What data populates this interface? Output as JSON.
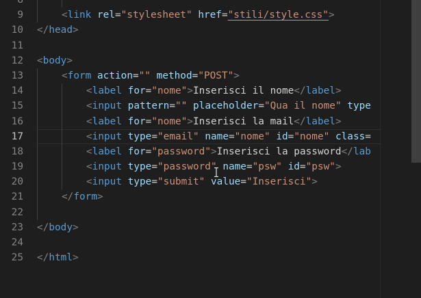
{
  "line_numbers": [
    "8",
    "9",
    "10",
    "11",
    "12",
    "13",
    "14",
    "15",
    "16",
    "17",
    "18",
    "19",
    "20",
    "21",
    "22",
    "23",
    "24",
    "25"
  ],
  "active_line": "17",
  "lines": [
    {
      "indent": 2,
      "tokens": []
    },
    {
      "indent": 1,
      "tokens": [
        {
          "t": "br",
          "v": "<"
        },
        {
          "t": "tag",
          "v": "link"
        },
        {
          "t": "txt",
          "v": " "
        },
        {
          "t": "at",
          "v": "rel"
        },
        {
          "t": "txt",
          "v": "="
        },
        {
          "t": "str",
          "v": "\"stylesheet\""
        },
        {
          "t": "txt",
          "v": " "
        },
        {
          "t": "at",
          "v": "href"
        },
        {
          "t": "txt",
          "v": "="
        },
        {
          "t": "str",
          "v": "\"stili/style.css\"",
          "u": true
        },
        {
          "t": "br",
          "v": ">"
        }
      ]
    },
    {
      "indent": 0,
      "tokens": [
        {
          "t": "br",
          "v": "</"
        },
        {
          "t": "tag",
          "v": "head"
        },
        {
          "t": "br",
          "v": ">"
        }
      ]
    },
    {
      "indent": 0,
      "tokens": []
    },
    {
      "indent": 0,
      "tokens": [
        {
          "t": "br",
          "v": "<"
        },
        {
          "t": "tag",
          "v": "body"
        },
        {
          "t": "br",
          "v": ">"
        }
      ]
    },
    {
      "indent": 1,
      "tokens": [
        {
          "t": "br",
          "v": "<"
        },
        {
          "t": "tag",
          "v": "form"
        },
        {
          "t": "txt",
          "v": " "
        },
        {
          "t": "at",
          "v": "action"
        },
        {
          "t": "txt",
          "v": "="
        },
        {
          "t": "str",
          "v": "\"\""
        },
        {
          "t": "txt",
          "v": " "
        },
        {
          "t": "at",
          "v": "method"
        },
        {
          "t": "txt",
          "v": "="
        },
        {
          "t": "str",
          "v": "\"POST\""
        },
        {
          "t": "br",
          "v": ">"
        }
      ]
    },
    {
      "indent": 2,
      "tokens": [
        {
          "t": "br",
          "v": "<"
        },
        {
          "t": "tag",
          "v": "label"
        },
        {
          "t": "txt",
          "v": " "
        },
        {
          "t": "at",
          "v": "for"
        },
        {
          "t": "txt",
          "v": "="
        },
        {
          "t": "str",
          "v": "\"nome\""
        },
        {
          "t": "br",
          "v": ">"
        },
        {
          "t": "txt",
          "v": "Inserisci il nome"
        },
        {
          "t": "br",
          "v": "</"
        },
        {
          "t": "tag",
          "v": "label"
        },
        {
          "t": "br",
          "v": ">"
        }
      ]
    },
    {
      "indent": 2,
      "tokens": [
        {
          "t": "br",
          "v": "<"
        },
        {
          "t": "tag",
          "v": "input"
        },
        {
          "t": "txt",
          "v": " "
        },
        {
          "t": "at",
          "v": "pattern"
        },
        {
          "t": "txt",
          "v": "="
        },
        {
          "t": "str",
          "v": "\"\""
        },
        {
          "t": "txt",
          "v": " "
        },
        {
          "t": "at",
          "v": "placeholder"
        },
        {
          "t": "txt",
          "v": "="
        },
        {
          "t": "str",
          "v": "\"Qua il nome\""
        },
        {
          "t": "txt",
          "v": " "
        },
        {
          "t": "at",
          "v": "type"
        }
      ]
    },
    {
      "indent": 2,
      "tokens": [
        {
          "t": "br",
          "v": "<"
        },
        {
          "t": "tag",
          "v": "label"
        },
        {
          "t": "txt",
          "v": " "
        },
        {
          "t": "at",
          "v": "for"
        },
        {
          "t": "txt",
          "v": "="
        },
        {
          "t": "str",
          "v": "\"nome\""
        },
        {
          "t": "br",
          "v": ">"
        },
        {
          "t": "txt",
          "v": "Inserisci la mail"
        },
        {
          "t": "br",
          "v": "</"
        },
        {
          "t": "tag",
          "v": "label"
        },
        {
          "t": "br",
          "v": ">"
        }
      ]
    },
    {
      "indent": 2,
      "current": true,
      "tokens": [
        {
          "t": "br",
          "v": "<"
        },
        {
          "t": "tag",
          "v": "input"
        },
        {
          "t": "txt",
          "v": " "
        },
        {
          "t": "at",
          "v": "type"
        },
        {
          "t": "txt",
          "v": "="
        },
        {
          "t": "str",
          "v": "\"email\""
        },
        {
          "t": "txt",
          "v": " "
        },
        {
          "t": "at",
          "v": "name"
        },
        {
          "t": "txt",
          "v": "="
        },
        {
          "t": "str",
          "v": "\"nome\""
        },
        {
          "t": "txt",
          "v": " "
        },
        {
          "t": "at",
          "v": "id"
        },
        {
          "t": "txt",
          "v": "="
        },
        {
          "t": "str",
          "v": "\"nome\""
        },
        {
          "t": "txt",
          "v": " "
        },
        {
          "t": "at",
          "v": "class"
        },
        {
          "t": "txt",
          "v": "="
        }
      ]
    },
    {
      "indent": 2,
      "tokens": [
        {
          "t": "br",
          "v": "<"
        },
        {
          "t": "tag",
          "v": "label"
        },
        {
          "t": "txt",
          "v": " "
        },
        {
          "t": "at",
          "v": "for"
        },
        {
          "t": "txt",
          "v": "="
        },
        {
          "t": "str",
          "v": "\"password\""
        },
        {
          "t": "br",
          "v": ">"
        },
        {
          "t": "txt",
          "v": "Inserisci la password"
        },
        {
          "t": "br",
          "v": "</"
        },
        {
          "t": "tag",
          "v": "lab"
        }
      ]
    },
    {
      "indent": 2,
      "tokens": [
        {
          "t": "br",
          "v": "<"
        },
        {
          "t": "tag",
          "v": "input"
        },
        {
          "t": "txt",
          "v": " "
        },
        {
          "t": "at",
          "v": "type"
        },
        {
          "t": "txt",
          "v": "="
        },
        {
          "t": "str",
          "v": "\"password\""
        },
        {
          "t": "txt",
          "v": " "
        },
        {
          "t": "at",
          "v": "name"
        },
        {
          "t": "txt",
          "v": "="
        },
        {
          "t": "str",
          "v": "\"psw\""
        },
        {
          "t": "txt",
          "v": " "
        },
        {
          "t": "at",
          "v": "id"
        },
        {
          "t": "txt",
          "v": "="
        },
        {
          "t": "str",
          "v": "\"psw\""
        },
        {
          "t": "br",
          "v": ">"
        }
      ]
    },
    {
      "indent": 2,
      "tokens": [
        {
          "t": "br",
          "v": "<"
        },
        {
          "t": "tag",
          "v": "input"
        },
        {
          "t": "txt",
          "v": " "
        },
        {
          "t": "at",
          "v": "type"
        },
        {
          "t": "txt",
          "v": "="
        },
        {
          "t": "str",
          "v": "\"submit\""
        },
        {
          "t": "txt",
          "v": " "
        },
        {
          "t": "at",
          "v": "value"
        },
        {
          "t": "txt",
          "v": "="
        },
        {
          "t": "str",
          "v": "\"Inserisci\""
        },
        {
          "t": "br",
          "v": ">"
        }
      ]
    },
    {
      "indent": 1,
      "tokens": [
        {
          "t": "br",
          "v": "</"
        },
        {
          "t": "tag",
          "v": "form"
        },
        {
          "t": "br",
          "v": ">"
        }
      ]
    },
    {
      "indent": 1,
      "tokens": []
    },
    {
      "indent": 0,
      "tokens": [
        {
          "t": "br",
          "v": "</"
        },
        {
          "t": "tag",
          "v": "body"
        },
        {
          "t": "br",
          "v": ">"
        }
      ]
    },
    {
      "indent": 0,
      "tokens": []
    },
    {
      "indent": 0,
      "tokens": [
        {
          "t": "br",
          "v": "</"
        },
        {
          "t": "tag",
          "v": "html"
        },
        {
          "t": "br",
          "v": ">"
        }
      ]
    }
  ],
  "colors": {
    "background": "#1e1e1e",
    "tag": "#569cd6",
    "bracket": "#808080",
    "attribute": "#9cdcfe",
    "string": "#ce9178",
    "text": "#d4d4d4",
    "line_number": "#858585",
    "line_number_active": "#c6c6c6"
  }
}
